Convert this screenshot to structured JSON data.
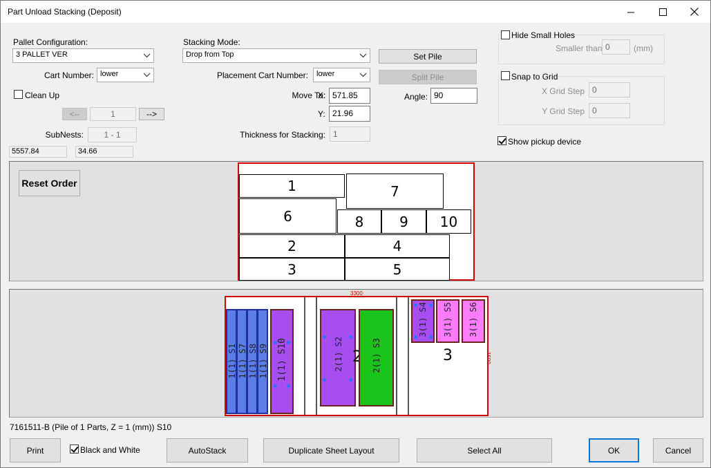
{
  "window": {
    "title": "Part Unload Stacking (Deposit)"
  },
  "pallet": {
    "label": "Pallet Configuration:",
    "value": "3 PALLET VER"
  },
  "cart": {
    "label": "Cart Number:",
    "value": "lower"
  },
  "cleanup": {
    "label": "Clean Up",
    "checked": false
  },
  "nav": {
    "prev": "<--",
    "value": "1",
    "next": "-->"
  },
  "subnests": {
    "label": "SubNests:",
    "value": "1 - 1"
  },
  "coords": {
    "x": "5557.84",
    "y": "34.66"
  },
  "stacking": {
    "label": "Stacking Mode:",
    "value": "Drop from Top"
  },
  "placement": {
    "label": "Placement Cart Number:",
    "value": "lower"
  },
  "move": {
    "label": "Move To:",
    "x_label": "X:",
    "x": "571.85",
    "y_label": "Y:",
    "y": "21.96"
  },
  "thickness": {
    "label": "Thickness for Stacking:",
    "value": "1"
  },
  "buttons": {
    "set_pile": "Set Pile",
    "split_pile": "Split Pile",
    "reset_order": "Reset Order",
    "print": "Print",
    "autostack": "AutoStack",
    "duplicate": "Duplicate Sheet Layout",
    "select_all": "Select All",
    "ok": "OK",
    "cancel": "Cancel"
  },
  "angle": {
    "label": "Angle:",
    "value": "90"
  },
  "hide_small": {
    "label": "Hide Small Holes",
    "smaller_label": "Smaller than:",
    "value": "0",
    "unit": "(mm)"
  },
  "snap": {
    "label": "Snap to Grid",
    "x_label": "X Grid Step",
    "x": "0",
    "y_label": "Y Grid Step",
    "y": "0"
  },
  "show_pickup": {
    "label": "Show pickup device",
    "checked": true
  },
  "piles": [
    "1",
    "7",
    "6",
    "8",
    "9",
    "10",
    "2",
    "4",
    "3",
    "5"
  ],
  "sheet": {
    "dim_w": "3300",
    "dim_h": "1500",
    "pallets": [
      "2",
      "3"
    ],
    "parts": [
      "1(1) S1",
      "1(1) S7",
      "1(1) S8",
      "1(1) S9",
      "1(1) S10",
      "2(1) S2",
      "2(1) S3",
      "3(1) S4",
      "3(1) S5",
      "3(1) S6"
    ]
  },
  "status": "7161511-B (Pile of 1 Parts, Z = 1 (mm)) S10",
  "bw": {
    "label": "Black and White",
    "checked": true
  },
  "colors": {
    "blue": "#5a7de8",
    "purple": "#a64ef0",
    "green": "#1bc41b",
    "pink": "#ff7bff",
    "frame": "#d00000"
  }
}
